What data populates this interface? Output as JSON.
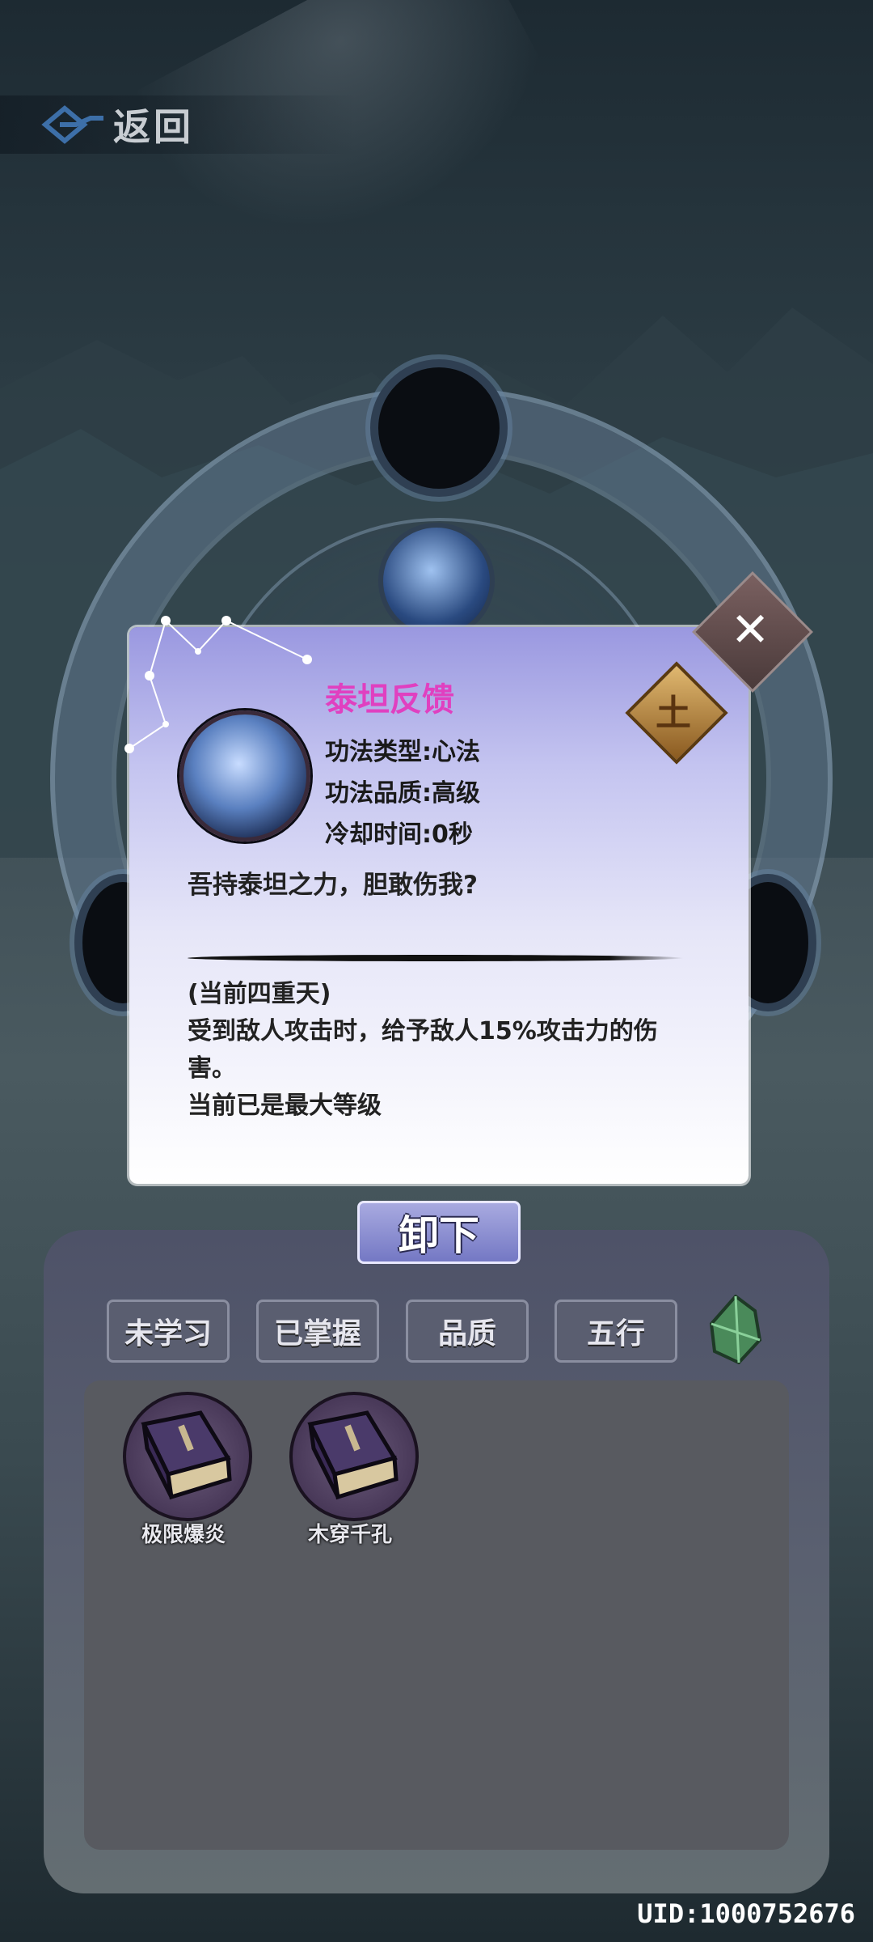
{
  "header": {
    "back_label": "返回",
    "back_icon": "diamond-arrow-icon"
  },
  "wheel": {
    "slots": [
      "empty-slot-top",
      "skill-slot-middle",
      "slot-left",
      "slot-right"
    ]
  },
  "skill_detail": {
    "name": "泰坦反馈",
    "type_line": "功法类型:心法",
    "quality_line": "功法品质:高级",
    "cooldown_line": "冷却时间:0秒",
    "quote": "吾持泰坦之力，胆敢伤我?",
    "level": "(当前四重天)",
    "effect_line1": "受到敌人攻击时，给予敌人15%攻击力的伤",
    "effect_line2": "害。",
    "max_level": "当前已是最大等级",
    "element_char": "土",
    "close_label": "✕",
    "name_color": "#e040c0"
  },
  "actions": {
    "unequip_label": "卸下"
  },
  "filters": [
    {
      "label": "未学习"
    },
    {
      "label": "已掌握"
    },
    {
      "label": "品质"
    },
    {
      "label": "五行"
    }
  ],
  "skill_list": [
    {
      "name": "极限爆炎",
      "icon": "book-icon"
    },
    {
      "name": "木穿千孔",
      "icon": "book-icon"
    }
  ],
  "footer": {
    "uid": "UID:1000752676"
  }
}
